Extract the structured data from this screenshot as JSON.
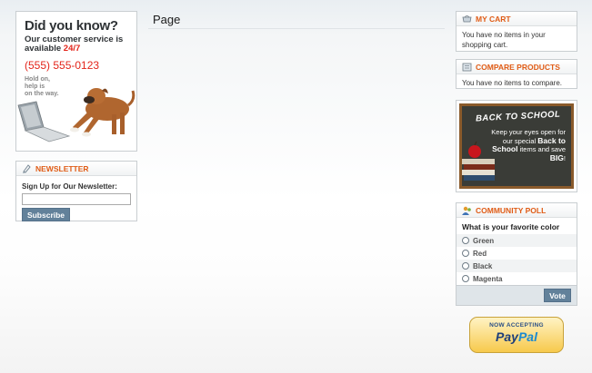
{
  "callout": {
    "heading": "Did you know?",
    "line1": "Our customer service is",
    "line2_prefix": "available ",
    "line2_highlight": "24/7",
    "phone": "(555) 555-0123",
    "hold_line1": "Hold on, help is",
    "hold_line2": "on the way."
  },
  "page": {
    "title": "Page"
  },
  "newsletter": {
    "title": "Newsletter",
    "label": "Sign Up for Our Newsletter:",
    "email_value": "",
    "button": "Subscribe"
  },
  "cart": {
    "title": "My Cart",
    "message": "You have no items in your shopping cart."
  },
  "compare": {
    "title": "Compare Products",
    "message": "You have no items to compare."
  },
  "promo": {
    "heading": "BACK TO SCHOOL",
    "text1": "Keep your eyes open for our special ",
    "bold1": "Back to School",
    "text2": " items and save ",
    "bold2": "BIG",
    "text3": "!"
  },
  "poll": {
    "title": "Community Poll",
    "question": "What is your favorite color",
    "options": [
      "Green",
      "Red",
      "Black",
      "Magenta"
    ],
    "button": "Vote"
  },
  "paypal": {
    "accepting": "NOW ACCEPTING",
    "brand_a": "Pay",
    "brand_b": "Pal"
  },
  "colors": {
    "accent": "#e05c16",
    "button": "#62819a",
    "phone": "#e3251b"
  },
  "icons": [
    "cart-icon",
    "compare-icon",
    "newsletter-icon",
    "poll-icon",
    "radio-icon"
  ]
}
